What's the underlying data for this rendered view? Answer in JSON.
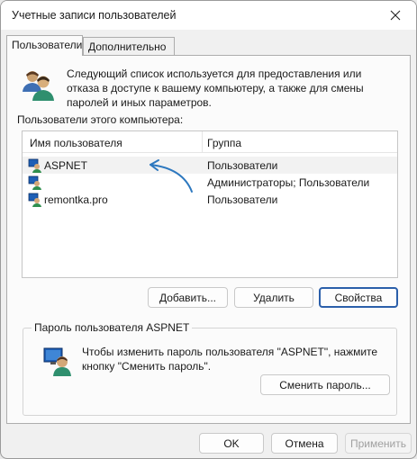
{
  "window": {
    "title": "Учетные записи пользователей"
  },
  "tabs": [
    {
      "label": "Пользователи"
    },
    {
      "label": "Дополнительно"
    }
  ],
  "intro_text": "Следующий список используется для предоставления или отказа в доступе к вашему компьютеру, а также для смены паролей и иных параметров.",
  "list": {
    "caption": "Пользователи этого компьютера:",
    "columns": [
      "Имя пользователя",
      "Группа"
    ],
    "rows": [
      {
        "user": "ASPNET",
        "group": "Пользователи",
        "selected": true
      },
      {
        "user": "",
        "group": "Администраторы; Пользователи",
        "selected": false
      },
      {
        "user": "remontka.pro",
        "group": "Пользователи",
        "selected": false
      }
    ]
  },
  "buttons": {
    "add": "Добавить...",
    "remove": "Удалить",
    "properties": "Свойства"
  },
  "password_group": {
    "title": "Пароль пользователя ASPNET",
    "text": "Чтобы изменить пароль пользователя \"ASPNET\", нажмите кнопку \"Сменить пароль\".",
    "button": "Сменить пароль..."
  },
  "dialog_buttons": {
    "ok": "OK",
    "cancel": "Отмена",
    "apply": "Применить"
  },
  "colors": {
    "arrow": "#2d78bf",
    "default_button_border": "#2b5faa"
  }
}
